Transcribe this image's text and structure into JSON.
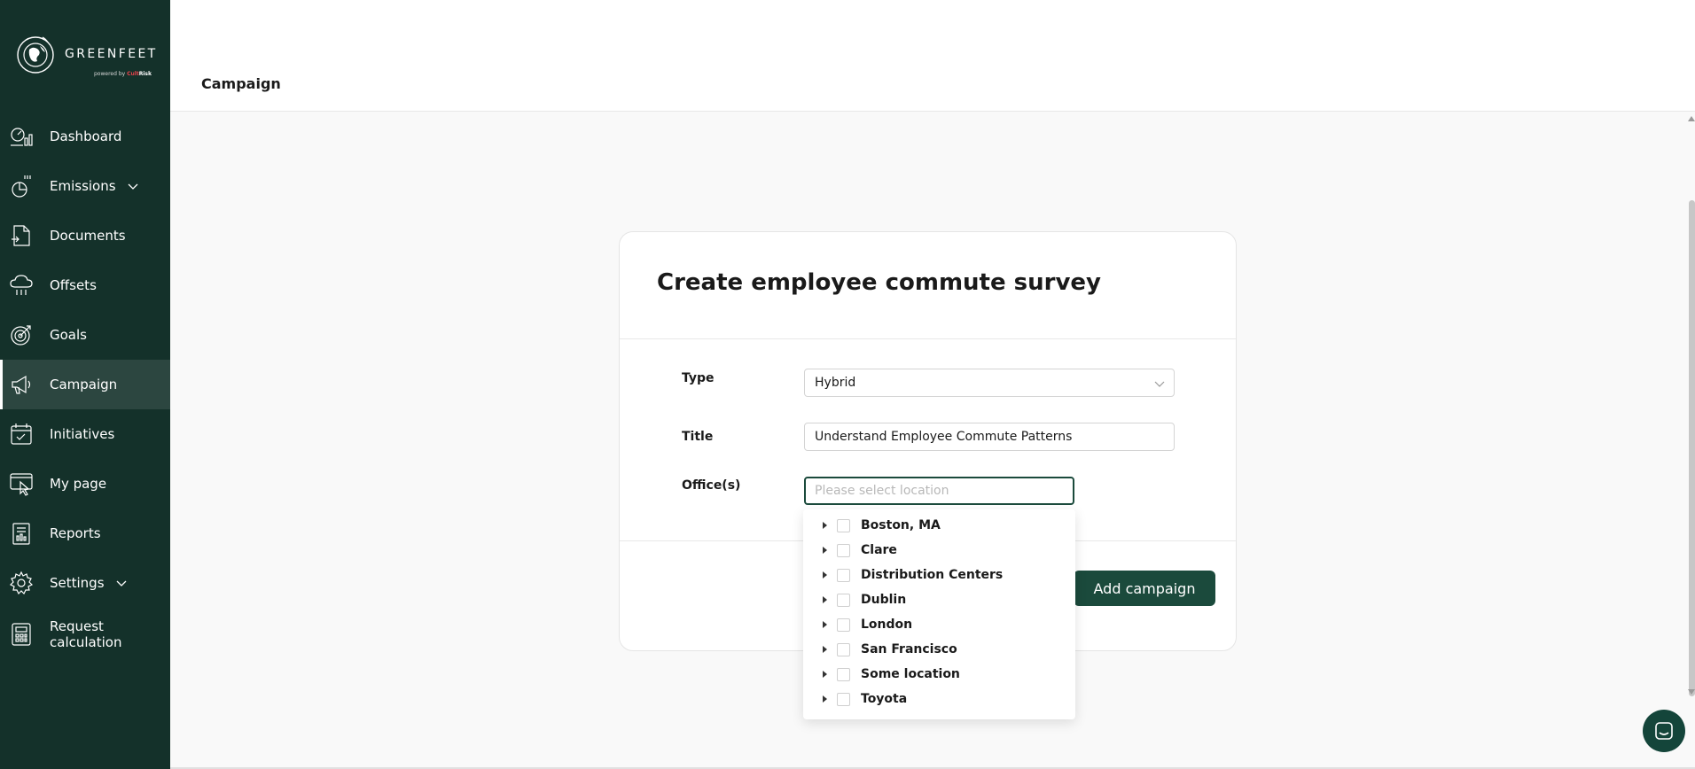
{
  "brand": {
    "name": "GREENFEET",
    "powered_by": "powered by",
    "company_a": "Cult",
    "company_b": "Risk"
  },
  "sidebar": {
    "items": [
      {
        "label": "Dashboard",
        "icon": "dashboard-icon"
      },
      {
        "label": "Emissions",
        "icon": "emissions-icon",
        "has_submenu": true
      },
      {
        "label": "Documents",
        "icon": "documents-icon"
      },
      {
        "label": "Offsets",
        "icon": "offsets-icon"
      },
      {
        "label": "Goals",
        "icon": "goals-icon"
      },
      {
        "label": "Campaign",
        "icon": "campaign-icon",
        "active": true
      },
      {
        "label": "Initiatives",
        "icon": "initiatives-icon"
      },
      {
        "label": "My page",
        "icon": "my-page-icon"
      },
      {
        "label": "Reports",
        "icon": "reports-icon"
      },
      {
        "label": "Settings",
        "icon": "settings-icon",
        "has_submenu": true
      },
      {
        "label": "Request calculation",
        "icon": "calculator-icon"
      }
    ]
  },
  "header": {
    "title": "Campaign"
  },
  "form": {
    "title": "Create employee commute survey",
    "type_label": "Type",
    "type_value": "Hybrid",
    "title_label": "Title",
    "title_value": "Understand Employee Commute Patterns",
    "offices_label": "Office(s)",
    "offices_placeholder": "Please select location",
    "submit_label": "Add campaign"
  },
  "locations": [
    "Boston, MA",
    "Clare",
    "Distribution Centers",
    "Dublin",
    "London",
    "San Francisco",
    "Some location",
    "Toyota"
  ],
  "colors": {
    "sidebar_bg": "#14312a",
    "sidebar_active": "#2c4640",
    "accent": "#1b4a3c"
  }
}
